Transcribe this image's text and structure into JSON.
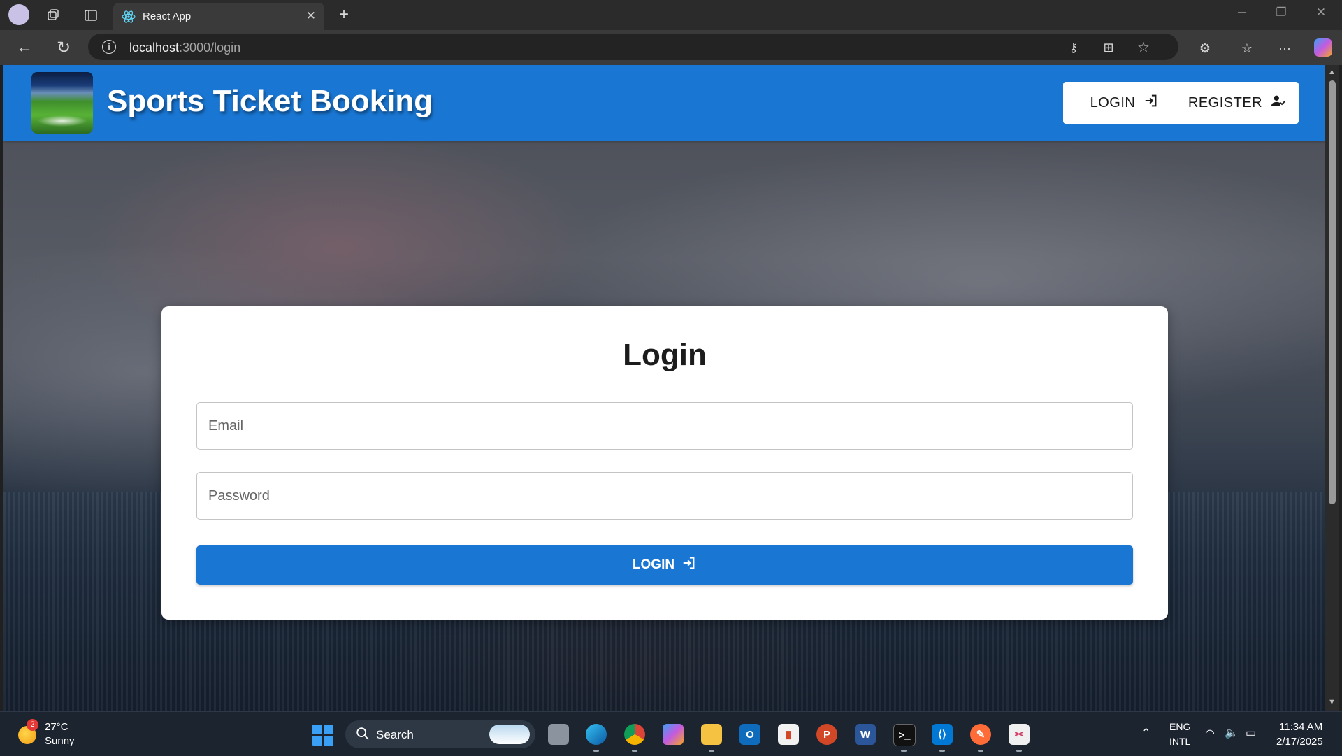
{
  "browser": {
    "tab_title": "React App",
    "url_host": "localhost",
    "url_rest": ":3000/login"
  },
  "header": {
    "brand": "Sports Ticket Booking",
    "login_label": "LOGIN",
    "register_label": "REGISTER"
  },
  "login_form": {
    "title": "Login",
    "email_placeholder": "Email",
    "password_placeholder": "Password",
    "submit_label": "LOGIN"
  },
  "taskbar": {
    "weather_temp": "27°C",
    "weather_desc": "Sunny",
    "weather_badge": "2",
    "search_label": "Search",
    "lang_top": "ENG",
    "lang_bottom": "INTL",
    "time": "11:34 AM",
    "date": "2/17/2025"
  },
  "colors": {
    "primary": "#1976d2",
    "card": "#ffffff",
    "taskbar": "#1c2430"
  }
}
